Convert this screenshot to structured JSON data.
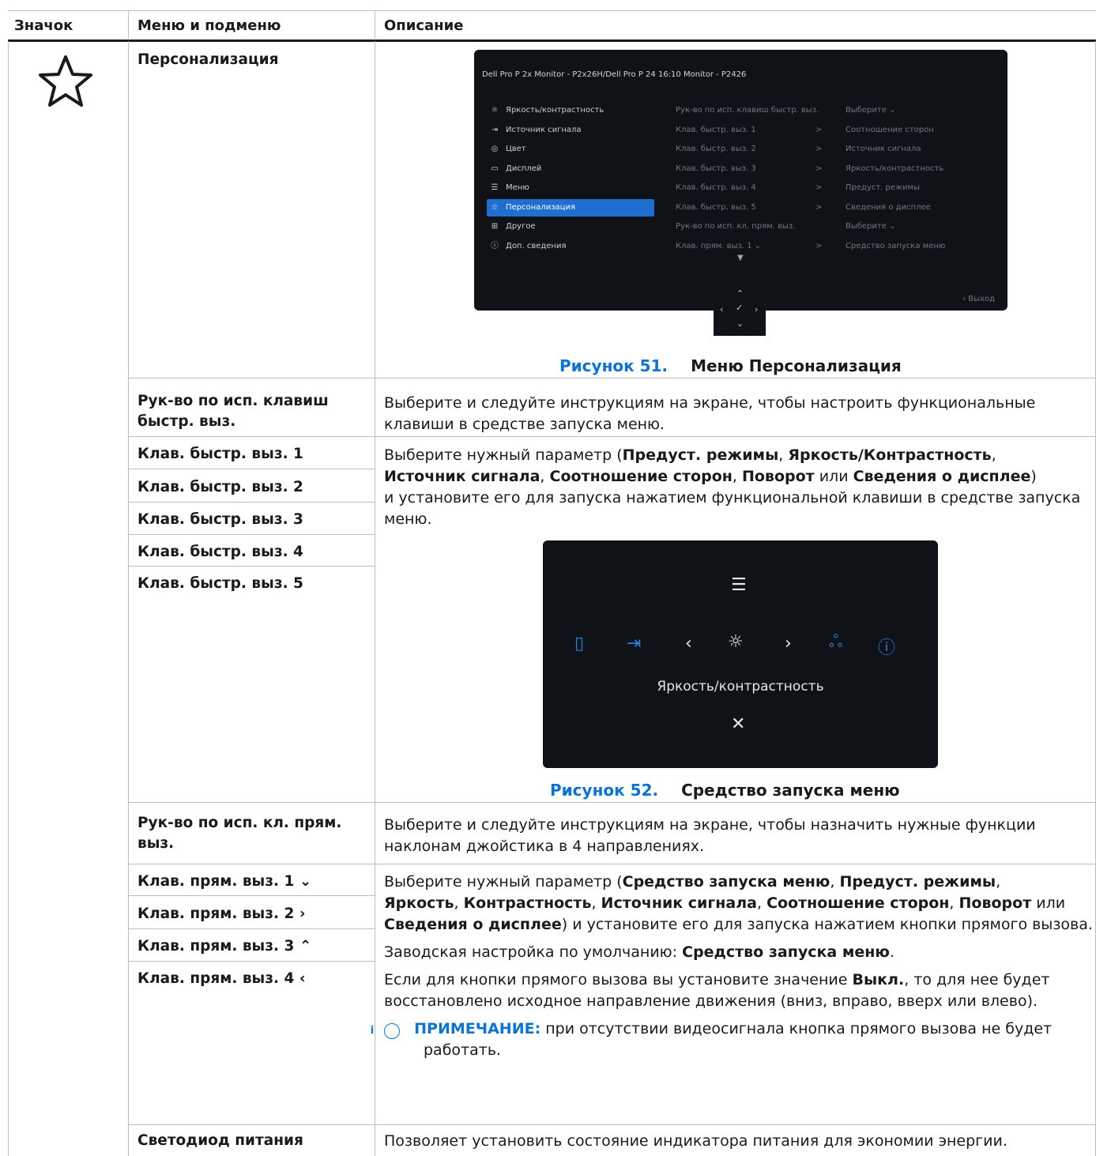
{
  "header": {
    "col1": "Значок",
    "col2": "Меню и подменю",
    "col3": "Описание"
  },
  "section_icon": "star-icon",
  "rows": {
    "personalization": "Персонализация",
    "key_guide": "Рук-во по исп. клавиш быстр. выз.",
    "key_guide_desc": "Выберите и следуйте инструкциям на экране, чтобы настроить функциональные клавиши в средстве запуска меню.",
    "shortcut_keys": [
      "Клав. быстр. выз. 1",
      "Клав. быстр. выз. 2",
      "Клав. быстр. выз. 3",
      "Клав. быстр. выз. 4",
      "Клав. быстр. выз. 5"
    ],
    "shortcut_desc": {
      "t1": "Выберите нужный параметр (",
      "b1": "Предуст. режимы",
      "b2": "Яркость/Контрастность",
      "b3": "Источник сигнала",
      "b4": "Соотношение сторон",
      "b5": "Поворот",
      "or": " или ",
      "b6": "Сведения о дисплее",
      "t2": "и установите его для запуска нажатием функциональной клавиши в средстве запуска меню."
    },
    "direct_guide": "Рук-во по исп. кл. прям. выз.",
    "direct_guide_desc": "Выберите и следуйте инструкциям на экране, чтобы назначить нужные функции наклонам джойстика в 4 направлениях.",
    "direct_keys": [
      {
        "label": "Клав. прям. выз. 1",
        "arrow": "⌄"
      },
      {
        "label": "Клав. прям. выз. 2",
        "arrow": "›"
      },
      {
        "label": "Клав. прям. выз. 3",
        "arrow": "⌃"
      },
      {
        "label": "Клав. прям. выз. 4",
        "arrow": "‹"
      }
    ],
    "direct_desc": {
      "t1": "Выберите нужный параметр (",
      "b1": "Средство запуска меню",
      "b2": "Предуст. режимы",
      "b3": "Яркость",
      "b4": "Контрастность",
      "b5": "Источник сигнала",
      "b6": "Соотношение сторон",
      "b7": "Поворот",
      "or": " или ",
      "b8": "Сведения о дисплее",
      "t2": ") и установите его для запуска нажатием кнопки прямого вызова.",
      "factory": "Заводская настройка по умолчанию: ",
      "factory_b": "Средство запуска меню",
      "off1": "Если для кнопки прямого вызова вы установите значение ",
      "off_b": "Выкл.",
      "off2": ", то для нее будет восстановлено исходное направление движения (вниз, вправо, вверх или влево).",
      "note_label": "ПРИМЕЧАНИЕ:",
      "note_text": " при отсутствии видеосигнала кнопка прямого вызова не будет работать."
    },
    "power_led": "Светодиод питания",
    "power_led_desc": "Позволяет установить состояние индикатора питания для экономии энергии."
  },
  "figures": {
    "fig51_num": "Рисунок 51.",
    "fig51_title": "Меню Персонализация",
    "fig52_num": "Рисунок 52.",
    "fig52_title": "Средство запуска меню"
  },
  "osd1": {
    "title": "Dell Pro P 2x Monitor - P2x26H/Dell Pro P 24 16:10 Monitor - P2426",
    "menu": [
      {
        "icon": "brightness-icon",
        "glyph": "☼",
        "label": "Яркость/контрастность"
      },
      {
        "icon": "input-source-icon",
        "glyph": "⇥",
        "label": "Источник сигнала"
      },
      {
        "icon": "color-icon",
        "glyph": "◎",
        "label": "Цвет"
      },
      {
        "icon": "display-icon",
        "glyph": "▭",
        "label": "Дисплей"
      },
      {
        "icon": "menu-icon",
        "glyph": "☰",
        "label": "Меню"
      },
      {
        "icon": "star-icon",
        "glyph": "☆",
        "label": "Персонализация"
      },
      {
        "icon": "other-icon",
        "glyph": "⊞",
        "label": "Другое"
      },
      {
        "icon": "info-icon",
        "glyph": "ⓘ",
        "label": "Доп. сведения"
      }
    ],
    "col2": [
      "Рук-во по исп. клавиш быстр. выз.",
      "Клав. быстр. выз. 1",
      "Клав. быстр. выз. 2",
      "Клав. быстр. выз. 3",
      "Клав. быстр. выз. 4",
      "Клав. быстр. выз. 5",
      "Рук-во по исп. кл. прям. выз.",
      "Клав. прям. выз. 1 ⌄"
    ],
    "col3": [
      "",
      ">",
      ">",
      ">",
      ">",
      ">",
      "",
      ">"
    ],
    "col4": [
      "Выберите ⌄",
      "Соотношение сторон",
      "Источник сигнала",
      "Яркость/контрастность",
      "Предуст. режимы",
      "Сведения о дисплее",
      "Выберите ⌄",
      "Средство запуска меню"
    ],
    "exit": "‹ Выход"
  },
  "osd2": {
    "label": "Яркость/контрастность"
  }
}
